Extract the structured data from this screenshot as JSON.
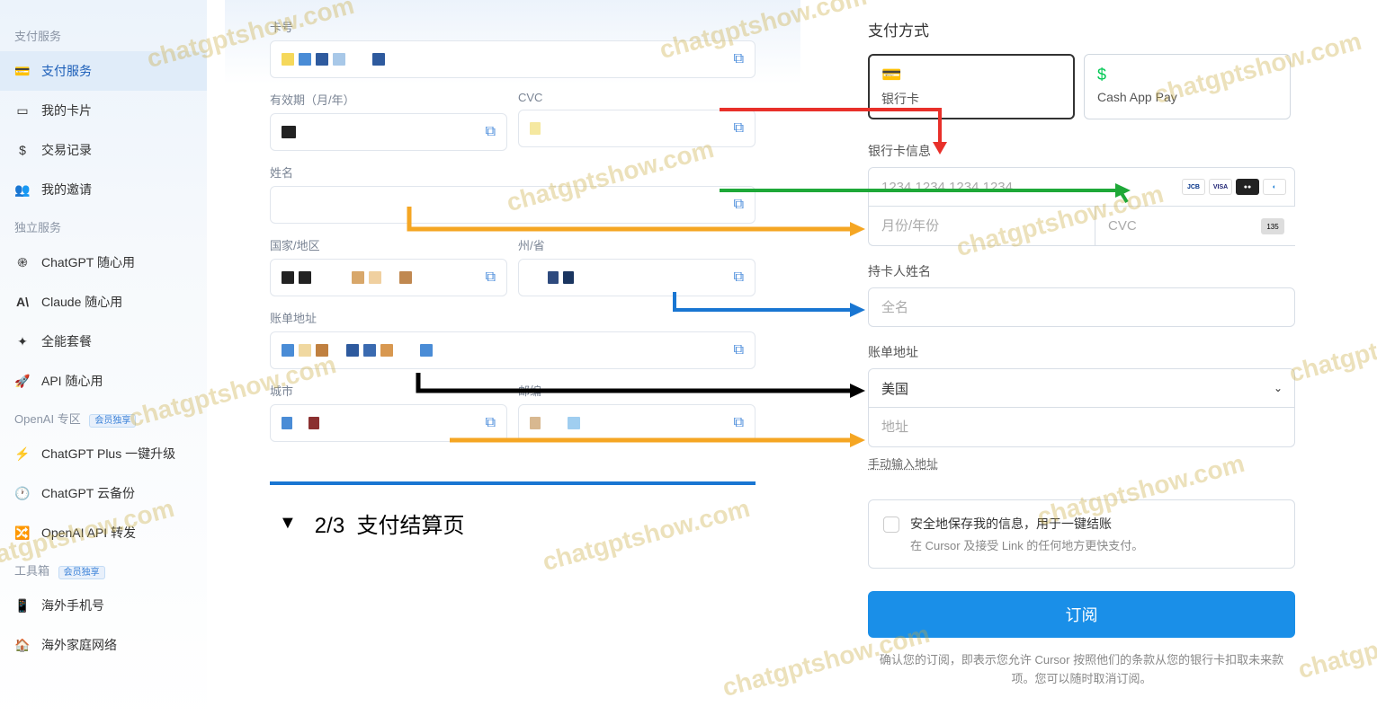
{
  "sidebar": {
    "section_payment": "支付服务",
    "section_standalone": "独立服务",
    "section_openai": "OpenAI 专区",
    "section_toolbox": "工具箱",
    "badge_exclusive": "会员独享",
    "items": {
      "payment_service": "支付服务",
      "my_cards": "我的卡片",
      "transactions": "交易记录",
      "my_invites": "我的邀请",
      "chatgpt": "ChatGPT 随心用",
      "claude": "Claude 随心用",
      "allpack": "全能套餐",
      "api": "API 随心用",
      "plus_upgrade": "ChatGPT Plus 一键升级",
      "cloud_backup": "ChatGPT 云备份",
      "api_forward": "OpenAI API 转发",
      "phone": "海外手机号",
      "family": "海外家庭网络"
    }
  },
  "left": {
    "card_number": "卡号",
    "expiry": "有效期（月/年）",
    "cvc": "CVC",
    "name": "姓名",
    "country": "国家/地区",
    "state": "州/省",
    "billing": "账单地址",
    "city": "城市",
    "postal": "邮编",
    "step_num": "2/3",
    "step_title": "支付结算页"
  },
  "right": {
    "title": "支付方式",
    "method_card": "银行卡",
    "method_cashapp": "Cash App Pay",
    "card_info": "银行卡信息",
    "card_placeholder": "1234 1234 1234 1234",
    "expiry_placeholder": "月份/年份",
    "cvc_placeholder": "CVC",
    "cardholder": "持卡人姓名",
    "fullname_placeholder": "全名",
    "billing_addr": "账单地址",
    "country_value": "美国",
    "address_placeholder": "地址",
    "manual_link": "手动输入地址",
    "save_title": "安全地保存我的信息，用于一键结账",
    "save_desc": "在 Cursor 及接受 Link 的任何地方更快支付。",
    "subscribe": "订阅",
    "disclaimer": "确认您的订阅，即表示您允许 Cursor 按照他们的条款从您的银行卡扣取未来款项。您可以随时取消订阅。"
  },
  "watermark": "chatgptshow.com"
}
